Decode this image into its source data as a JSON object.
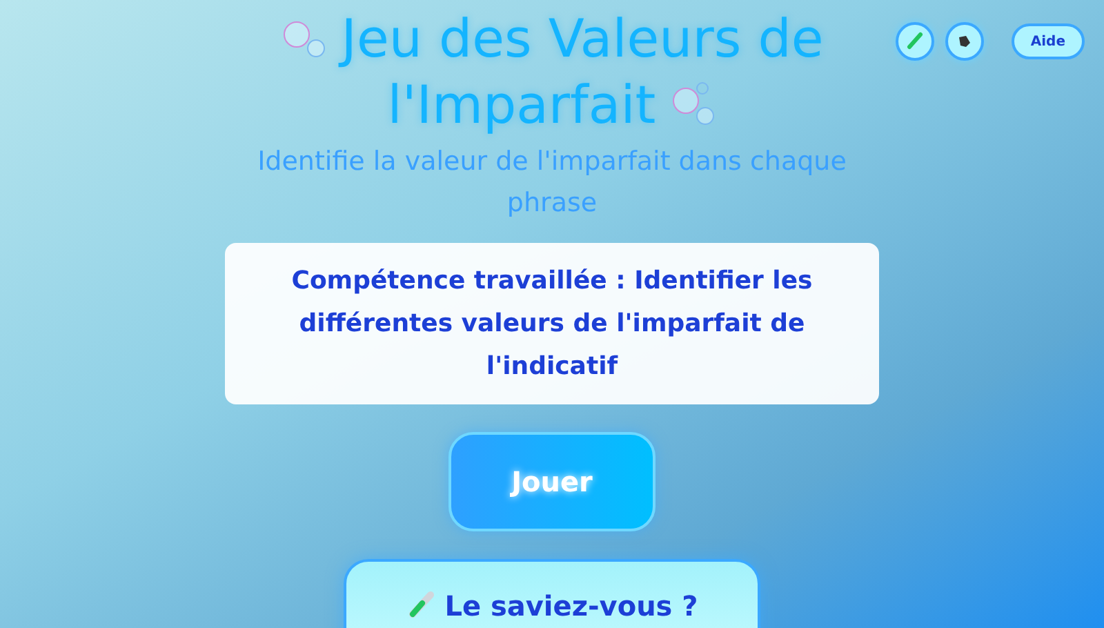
{
  "header": {
    "title_line_1": "Jeu des Valeurs de",
    "title_line_2": "l'Imparfait",
    "subtitle": "Identifie la valeur de l'imparfait dans chaque phrase"
  },
  "toolbar": {
    "help_button": "Aide"
  },
  "skill_card": {
    "text": "Compétence travaillée : Identifier les différentes valeurs de l'imparfait de l'indicatif"
  },
  "play_button": "Jouer",
  "did_you_know": {
    "title": "Le saviez-vous ?"
  }
}
